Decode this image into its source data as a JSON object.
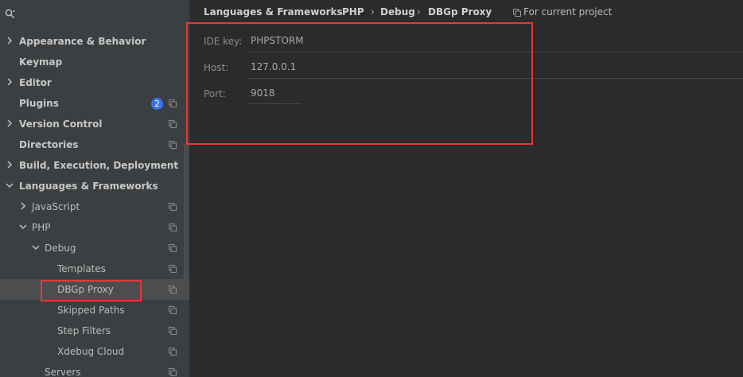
{
  "sidebar": {
    "items": [
      {
        "label": "Appearance & Behavior",
        "bold": true,
        "expand": "collapsed",
        "indent": 0
      },
      {
        "label": "Keymap",
        "bold": true,
        "expand": "none",
        "indent": 0
      },
      {
        "label": "Editor",
        "bold": true,
        "expand": "collapsed",
        "indent": 0
      },
      {
        "label": "Plugins",
        "bold": true,
        "expand": "none",
        "indent": 0,
        "badge": "2",
        "copy": true
      },
      {
        "label": "Version Control",
        "bold": true,
        "expand": "collapsed",
        "indent": 0,
        "copy": true
      },
      {
        "label": "Directories",
        "bold": true,
        "expand": "none",
        "indent": 0,
        "copy": true
      },
      {
        "label": "Build, Execution, Deployment",
        "bold": true,
        "expand": "collapsed",
        "indent": 0
      },
      {
        "label": "Languages & Frameworks",
        "bold": true,
        "expand": "expanded",
        "indent": 0
      },
      {
        "label": "JavaScript",
        "bold": false,
        "expand": "collapsed",
        "indent": 1,
        "copy": true
      },
      {
        "label": "PHP",
        "bold": false,
        "expand": "expanded",
        "indent": 1,
        "copy": true
      },
      {
        "label": "Debug",
        "bold": false,
        "expand": "expanded",
        "indent": 2,
        "copy": true
      },
      {
        "label": "Templates",
        "bold": false,
        "expand": "none",
        "indent": 3,
        "copy": true
      },
      {
        "label": "DBGp Proxy",
        "bold": false,
        "expand": "none",
        "indent": 3,
        "copy": true,
        "selected": true
      },
      {
        "label": "Skipped Paths",
        "bold": false,
        "expand": "none",
        "indent": 3,
        "copy": true
      },
      {
        "label": "Step Filters",
        "bold": false,
        "expand": "none",
        "indent": 3,
        "copy": true
      },
      {
        "label": "Xdebug Cloud",
        "bold": false,
        "expand": "none",
        "indent": 3,
        "copy": true
      },
      {
        "label": "Servers",
        "bold": false,
        "expand": "none",
        "indent": 2,
        "copy": true
      }
    ]
  },
  "breadcrumb": {
    "items": [
      "Languages & Frameworks",
      "PHP",
      "Debug",
      "DBGp Proxy"
    ],
    "separator": "›",
    "scope_label": "For current project"
  },
  "form": {
    "ide_key": {
      "label": "IDE key:",
      "value": "PHPSTORM"
    },
    "host": {
      "label": "Host:",
      "value": "127.0.0.1"
    },
    "port": {
      "label": "Port:",
      "value": "9018"
    }
  },
  "colors": {
    "accent_badge": "#3574f0",
    "highlight": "#e53935",
    "selected_row": "#4b4d4f"
  },
  "icons": {
    "search": "search-icon",
    "copy": "copy-icon",
    "chevron_right": "chevron-right-icon",
    "chevron_down": "chevron-down-icon"
  }
}
